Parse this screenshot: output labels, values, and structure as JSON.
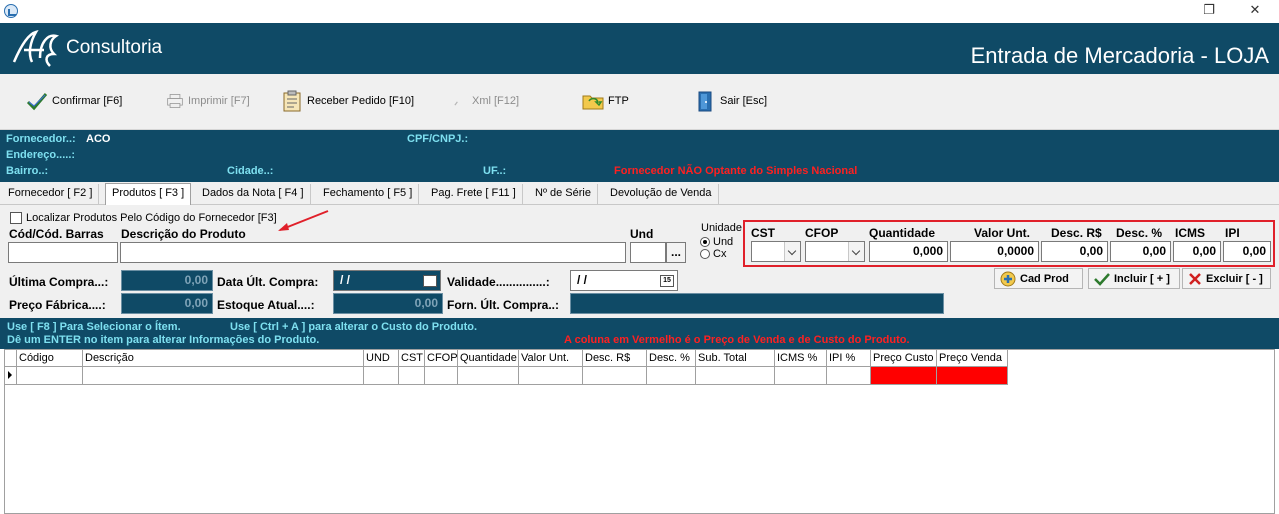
{
  "window": {
    "restore_icon": "restore-icon",
    "close_icon": "close-icon"
  },
  "banner": {
    "logo_text": "Consultoria",
    "title": "Entrada de Mercadoria - LOJA"
  },
  "toolbar": {
    "confirmar": "Confirmar [F6]",
    "imprimir": "Imprimir  [F7]",
    "receber": "Receber Pedido [F10]",
    "xml": "Xml [F12]",
    "ftp": "FTP",
    "sair": "Sair [Esc]"
  },
  "supplier": {
    "fornecedor_label": "Fornecedor..:",
    "fornecedor_value": "ACO",
    "cpf_label": "CPF/CNPJ.:",
    "endereco_label": "Endereço.....:",
    "bairro_label": "Bairro..:",
    "cidade_label": "Cidade..:",
    "uf_label": "UF..:",
    "warning": "Fornecedor NÃO Optante do Simples Nacional"
  },
  "tabs": [
    "Fornecedor [ F2 ]",
    "Produtos [ F3 ]",
    "Dados da Nota [ F4 ]",
    "Fechamento [ F5 ]",
    "Pag. Frete [ F11 ]",
    "Nº de Série",
    "Devolução de Venda"
  ],
  "form": {
    "localizar_label": "Localizar Produtos Pelo Código do Fornecedor [F3]",
    "cod_label": "Cód/Cód. Barras",
    "desc_label": "Descrição do Produto",
    "und_label": "Und",
    "ellipsis": "...",
    "unidade_label": "Unidade",
    "unidade_und": "Und",
    "unidade_cx": "Cx",
    "cst_label": "CST",
    "cfop_label": "CFOP",
    "quantidade_label": "Quantidade",
    "valor_unt_label": "Valor Unt.",
    "desc_rs_label": "Desc. R$",
    "desc_pct_label": "Desc. %",
    "icms_label": "ICMS",
    "ipi_label": "IPI",
    "quantidade_value": "0,000",
    "valor_unt_value": "0,0000",
    "desc_rs_value": "0,00",
    "desc_pct_value": "0,00",
    "icms_value": "0,00",
    "ipi_value": "0,00",
    "ultima_compra_label": "Última Compra...:",
    "ultima_compra_value": "0,00",
    "data_ult_compra_label": "Data Últ. Compra:",
    "data_ult_compra_value": "/  /",
    "validade_label": "Validade...............:",
    "validade_value": "/  /",
    "preco_fabrica_label": "Preço Fábrica....:",
    "preco_fabrica_value": "0,00",
    "estoque_atual_label": "Estoque Atual....:",
    "estoque_atual_value": "0,00",
    "forn_ult_compra_label": "Forn. Últ. Compra..:",
    "cad_prod": "Cad Prod",
    "incluir": "Incluir [ + ]",
    "excluir": "Excluir [ - ]"
  },
  "help": {
    "line1a": "Use [ F8 ] Para Selecionar o Ítem.",
    "line1b": "Use [ Ctrl + A ] para alterar o Custo do Produto.",
    "line2": "Dê um ENTER no item para alterar Informações do Produto.",
    "red_note": "A coluna em Vermelho é o Preço de Venda e de Custo do Produto."
  },
  "grid": {
    "columns": [
      "Código",
      "Descrição",
      "UND",
      "CST",
      "CFOP",
      "Quantidade",
      "Valor Unt.",
      "Desc. R$",
      "Desc. %",
      "Sub. Total",
      "ICMS %",
      "IPI %",
      "Preço Custo",
      "Preço Venda"
    ],
    "highlight_color": "#ff0000"
  },
  "colors": {
    "brand": "#0f4a66",
    "label_cyan": "#7ee0f0",
    "warning_red": "#ff2020",
    "annotation_red": "#e0202a"
  }
}
